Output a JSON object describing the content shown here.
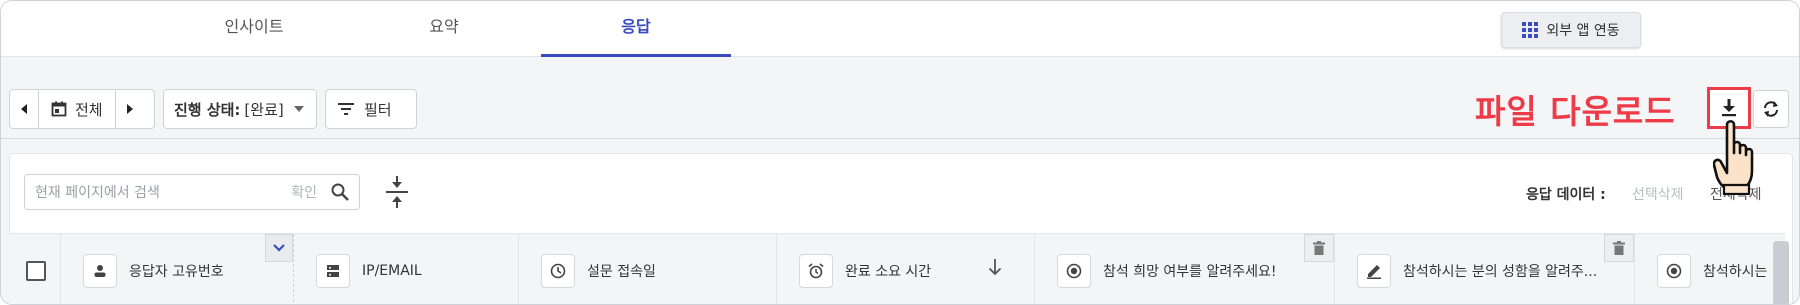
{
  "tabs": [
    {
      "label": "인사이트"
    },
    {
      "label": "요약"
    },
    {
      "label": "응답",
      "active": true
    }
  ],
  "external_app_button": "외부 앱 연동",
  "toolbar": {
    "date_label": "전체",
    "status_prefix": "진행 상태: ",
    "status_value": "[완료]",
    "filter_label": "필터"
  },
  "annotation": "파일 다운로드",
  "search": {
    "placeholder": "현재 페이지에서 검색",
    "confirm": "확인"
  },
  "response_data": {
    "label": "응답 데이터 :",
    "select_delete": "선택삭제",
    "delete_all": "전체삭제"
  },
  "columns": [
    {
      "label": "응답자 고유번호",
      "icon": "person-icon"
    },
    {
      "label": "IP/EMAIL",
      "icon": "server-icon"
    },
    {
      "label": "설문 접속일",
      "icon": "clock-icon"
    },
    {
      "label": "완료 소요 시간",
      "icon": "alarm-icon"
    },
    {
      "label": "참석 희망 여부를 알려주세요!",
      "icon": "radio-icon"
    },
    {
      "label": "참석하시는 분의 성함을 알려주...",
      "icon": "pencil-icon"
    },
    {
      "label": "참석하시는",
      "icon": "radio-icon"
    }
  ],
  "colors": {
    "accent": "#3b4cc0",
    "annotation": "#ee3b48"
  }
}
